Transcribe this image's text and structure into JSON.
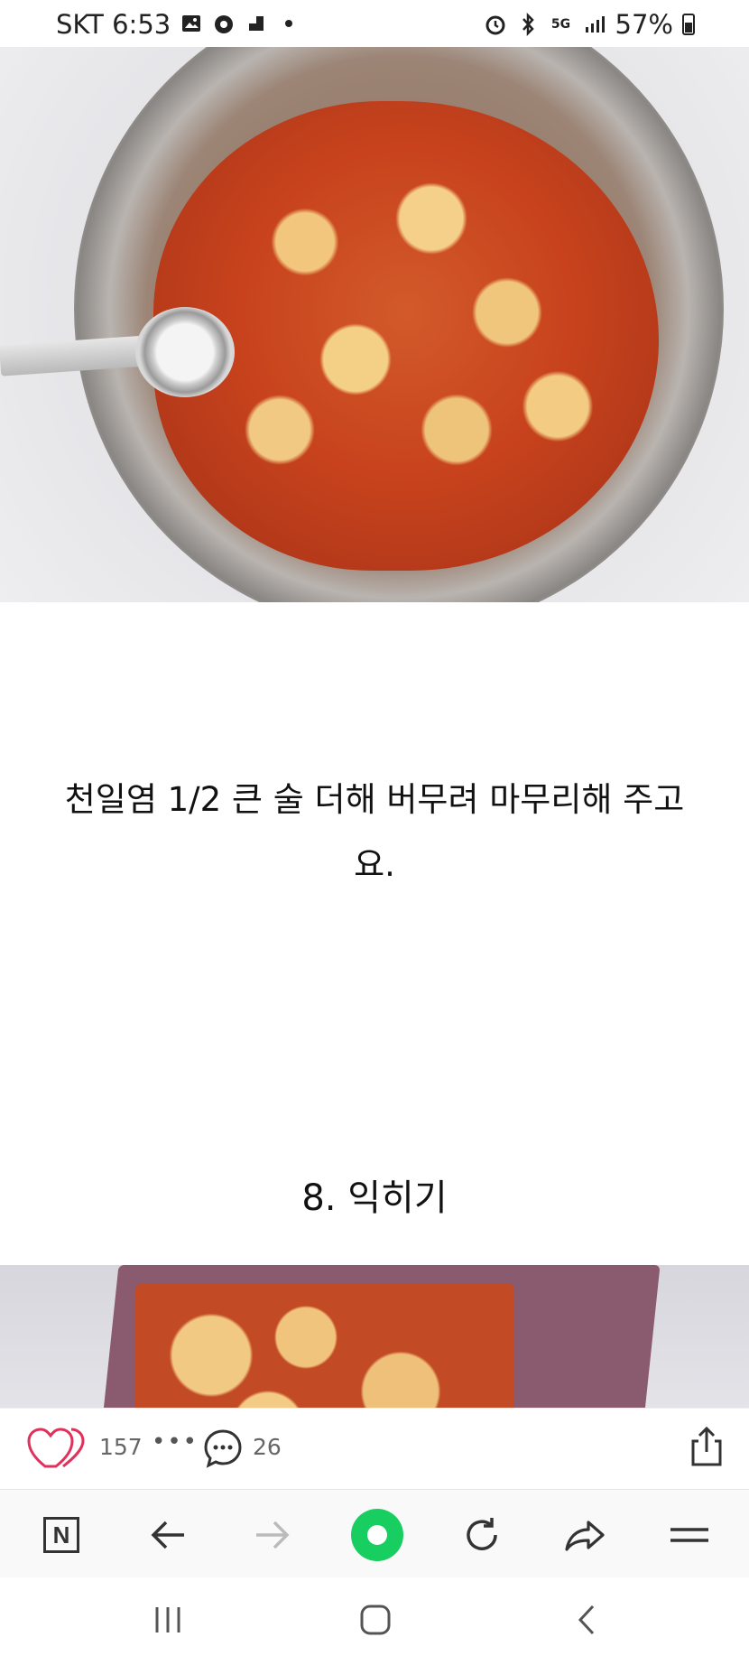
{
  "status_bar": {
    "carrier_time": "SKT 6:53",
    "network": "5G",
    "battery": "57%",
    "icons": [
      "gallery-icon",
      "settings-icon",
      "app-icon",
      "dot-icon",
      "alarm-icon",
      "bluetooth-icon",
      "network-5g-icon",
      "signal-icon",
      "battery-icon"
    ]
  },
  "article": {
    "caption_line1": "천일염 1/2 큰 술 더해 버무려 마무리해 주고",
    "caption_line2": "요.",
    "section_heading": "8. 익히기"
  },
  "action_bar": {
    "likes": "157",
    "more": "•••",
    "comments": "26",
    "like_color": "#e0315b"
  },
  "browser_bar": {
    "home_label": "N",
    "accent": "#19ce60"
  }
}
